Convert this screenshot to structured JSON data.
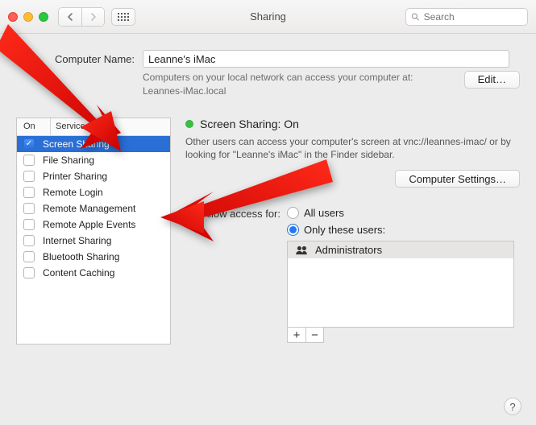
{
  "window": {
    "title": "Sharing"
  },
  "search": {
    "placeholder": "Search",
    "value": ""
  },
  "computer_name": {
    "label": "Computer Name:",
    "value": "Leanne's iMac"
  },
  "subtitle": {
    "line1": "Computers on your local network can access your computer at:",
    "line2": "Leannes-iMac.local"
  },
  "buttons": {
    "edit": "Edit…",
    "computer_settings": "Computer Settings…",
    "help": "?"
  },
  "services": {
    "header_on": "On",
    "header_service": "Service",
    "items": [
      {
        "label": "Screen Sharing",
        "on": true,
        "selected": true
      },
      {
        "label": "File Sharing",
        "on": false
      },
      {
        "label": "Printer Sharing",
        "on": false
      },
      {
        "label": "Remote Login",
        "on": false
      },
      {
        "label": "Remote Management",
        "on": false
      },
      {
        "label": "Remote Apple Events",
        "on": false
      },
      {
        "label": "Internet Sharing",
        "on": false
      },
      {
        "label": "Bluetooth Sharing",
        "on": false
      },
      {
        "label": "Content Caching",
        "on": false
      }
    ]
  },
  "detail": {
    "status_label": "Screen Sharing: On",
    "status_color": "#37c144",
    "desc": "Other users can access your computer's screen at vnc://leannes-imac/ or by looking for \"Leanne's iMac\" in the Finder sidebar."
  },
  "access": {
    "label": "Allow access for:",
    "all_users": "All users",
    "only_these": "Only these users:",
    "selected": "only"
  },
  "users": {
    "items": [
      {
        "label": "Administrators"
      }
    ],
    "icons": {
      "add": "+",
      "remove": "−"
    }
  }
}
